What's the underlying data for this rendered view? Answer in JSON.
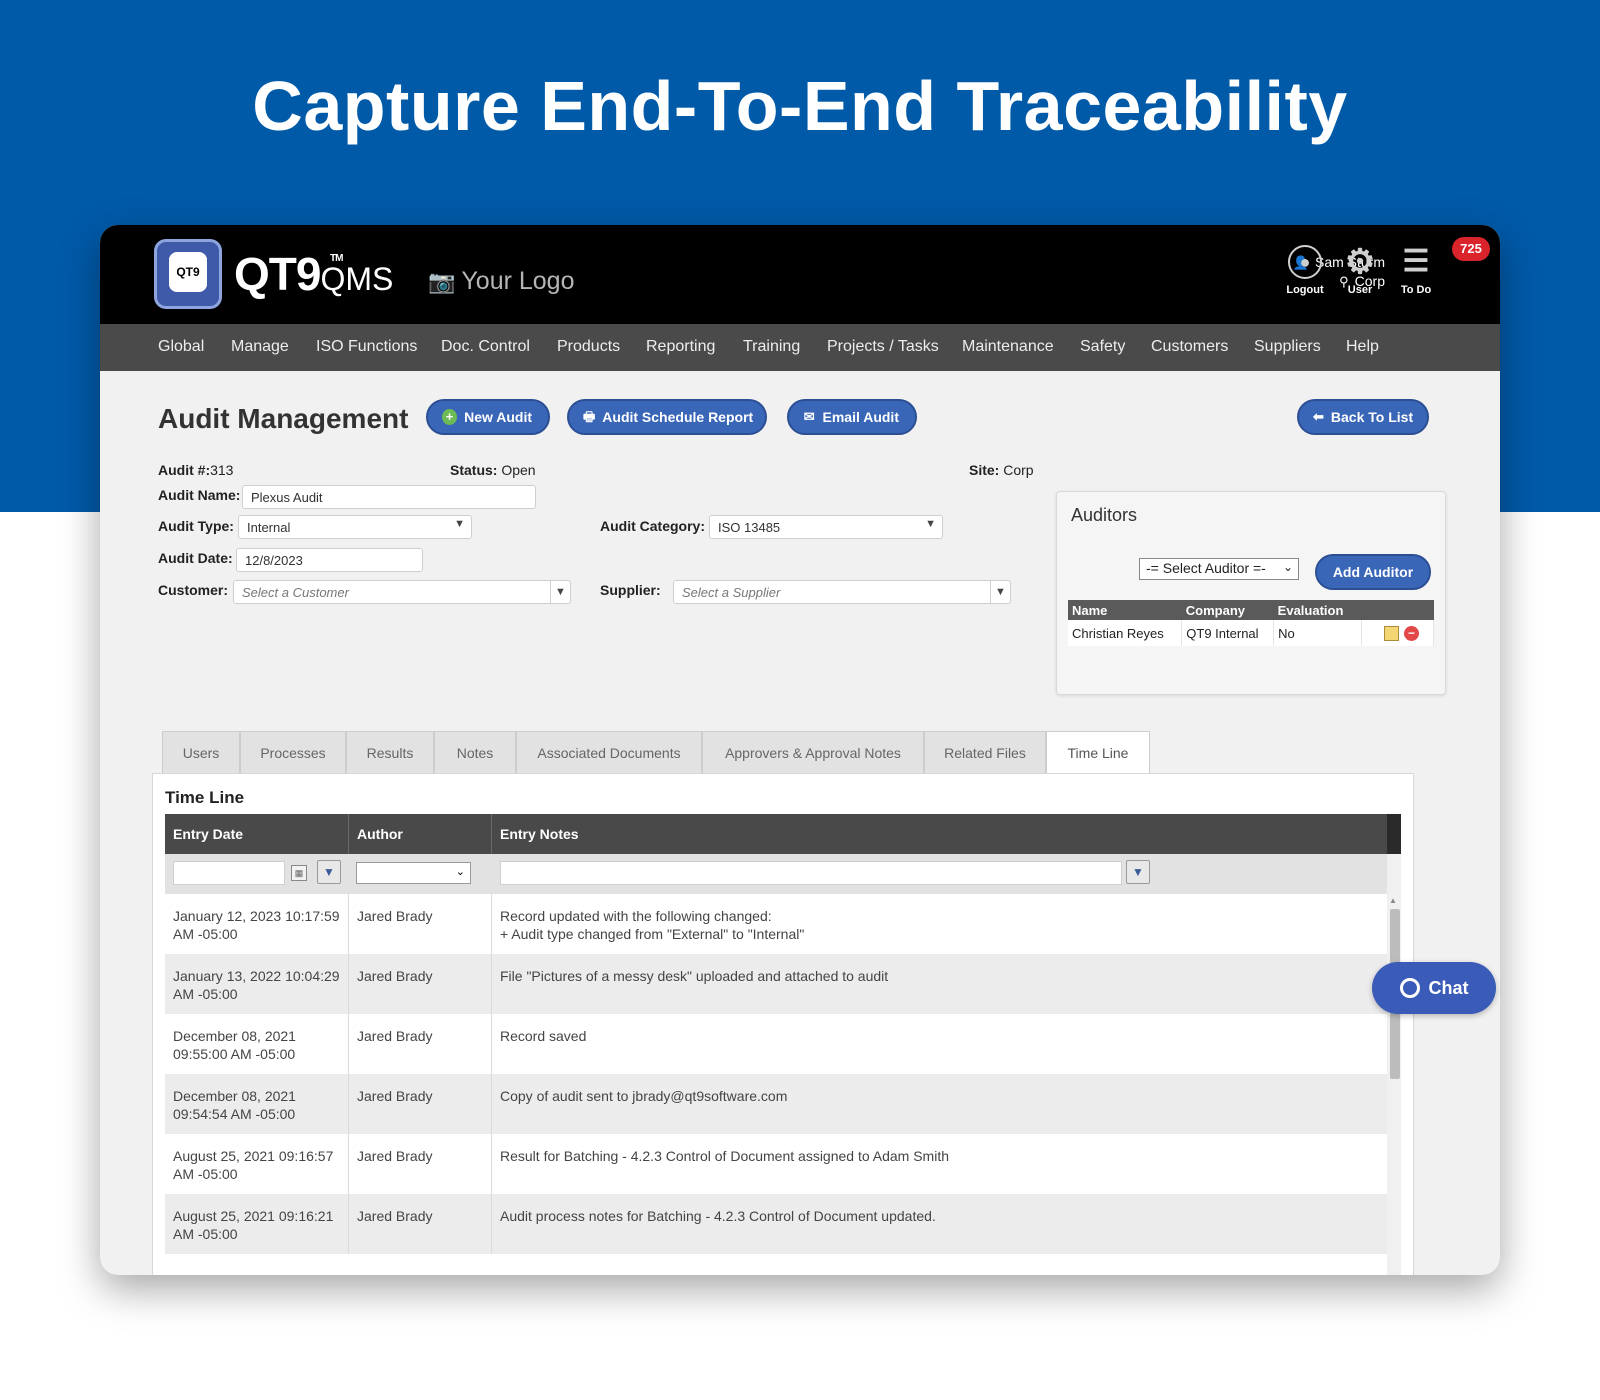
{
  "hero": {
    "title": "Capture End-To-End Traceability"
  },
  "colors": {
    "hero_bg": "#005aa8",
    "topbar": "#000000",
    "nav": "#4a4a4a",
    "button": "#3a66b8",
    "badge": "#d9242b"
  },
  "app": {
    "brand": "QT9",
    "brand_suffix": "QMS",
    "tm": "TM",
    "logo_text": "QT9",
    "your_logo": "Your Logo",
    "user_name": "Sam Sturm",
    "site": "Corp",
    "icons": [
      {
        "label": "Logout",
        "icon": "logout-icon"
      },
      {
        "label": "User",
        "icon": "gear-icon"
      },
      {
        "label": "To Do",
        "icon": "todo-list-icon"
      }
    ],
    "todo_count": "725"
  },
  "nav": {
    "items": [
      "Global",
      "Manage",
      "ISO Functions",
      "Doc. Control",
      "Products",
      "Reporting",
      "Training",
      "Projects / Tasks",
      "Maintenance",
      "Safety",
      "Customers",
      "Suppliers",
      "Help"
    ]
  },
  "page": {
    "title": "Audit Management",
    "buttons": {
      "new_audit": "New Audit",
      "schedule_report": "Audit Schedule Report",
      "email_audit": "Email Audit",
      "back": "Back To List"
    }
  },
  "form": {
    "audit_no_label": "Audit #:",
    "audit_no": "313",
    "status_label": "Status:",
    "status": "Open",
    "site_label": "Site:",
    "site": "Corp",
    "audit_name_label": "Audit Name:",
    "audit_name": "Plexus Audit",
    "audit_type_label": "Audit Type:",
    "audit_type": "Internal",
    "audit_category_label": "Audit Category:",
    "audit_category": "ISO 13485",
    "audit_date_label": "Audit Date:",
    "audit_date": "12/8/2023",
    "customer_label": "Customer:",
    "customer_placeholder": "Select a Customer",
    "supplier_label": "Supplier:",
    "supplier_placeholder": "Select a Supplier"
  },
  "auditors": {
    "title": "Auditors",
    "select": "-= Select Auditor =-",
    "add_button": "Add Auditor",
    "headers": [
      "Name",
      "Company",
      "Evaluation"
    ],
    "rows": [
      {
        "name": "Christian Reyes",
        "company": "QT9 Internal",
        "evaluation": "No"
      }
    ]
  },
  "tabs": [
    "Users",
    "Processes",
    "Results",
    "Notes",
    "Associated Documents",
    "Approvers & Approval Notes",
    "Related Files",
    "Time Line"
  ],
  "active_tab": "Time Line",
  "timeline": {
    "title": "Time Line",
    "headers": {
      "date": "Entry Date",
      "author": "Author",
      "notes": "Entry Notes"
    },
    "rows": [
      {
        "date1": "January 12, 2023 10:17:59",
        "date2": "AM -05:00",
        "author": "Jared Brady",
        "note1": "Record updated with the following changed:",
        "note2": "+ Audit type changed from \"External\" to \"Internal\""
      },
      {
        "date1": "January 13, 2022 10:04:29",
        "date2": "AM -05:00",
        "author": "Jared Brady",
        "note1": "File \"Pictures of a messy desk\" uploaded and attached to audit",
        "note2": ""
      },
      {
        "date1": "December 08, 2021",
        "date2": "09:55:00 AM -05:00",
        "author": "Jared Brady",
        "note1": "Record saved",
        "note2": ""
      },
      {
        "date1": "December 08, 2021",
        "date2": "09:54:54 AM -05:00",
        "author": "Jared Brady",
        "note1": "Copy of audit sent to jbrady@qt9software.com",
        "note2": ""
      },
      {
        "date1": "August 25, 2021 09:16:57",
        "date2": "AM -05:00",
        "author": "Jared Brady",
        "note1": "Result for Batching - 4.2.3 Control of Document assigned to Adam Smith",
        "note2": ""
      },
      {
        "date1": "August 25, 2021 09:16:21",
        "date2": "AM -05:00",
        "author": "Jared Brady",
        "note1": "Audit process notes for Batching - 4.2.3 Control of Document updated.",
        "note2": ""
      }
    ]
  },
  "chat": {
    "label": "Chat"
  }
}
